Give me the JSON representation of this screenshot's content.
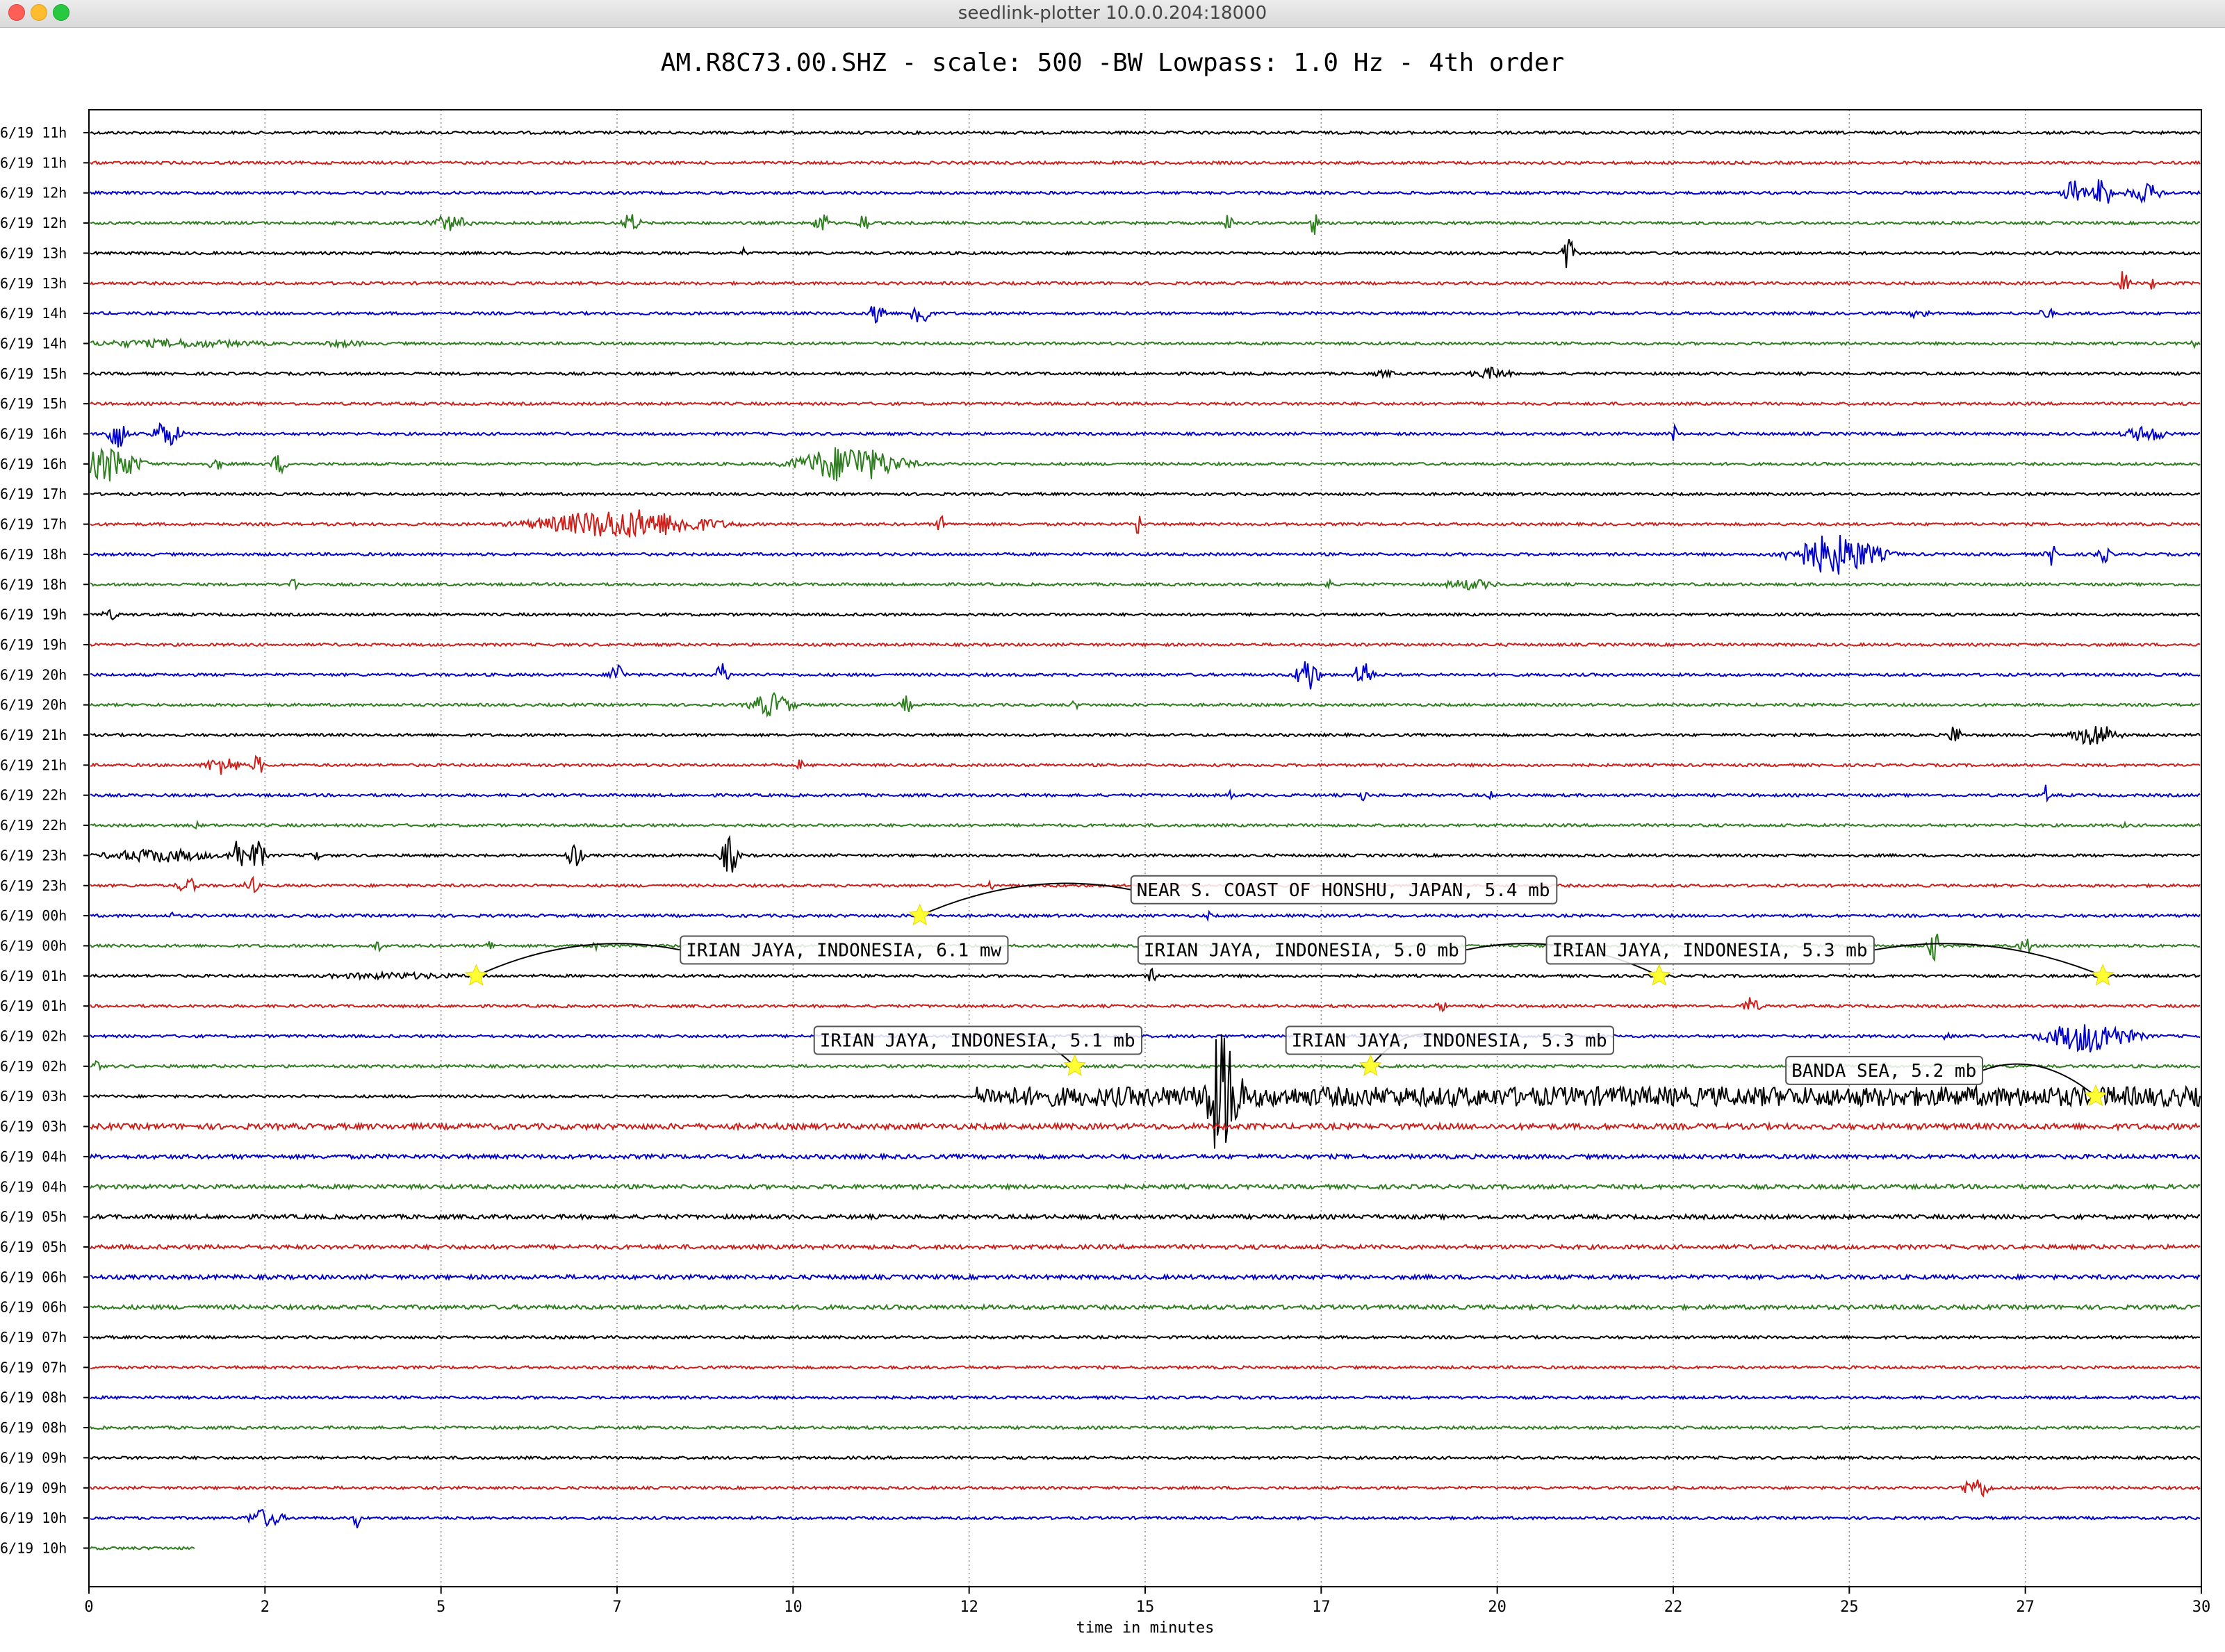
{
  "window": {
    "title": "seedlink-plotter 10.0.0.204:18000"
  },
  "chart_data": {
    "type": "line",
    "title": "AM.R8C73.00.SHZ - scale: 500 -BW Lowpass: 1.0 Hz - 4th order",
    "xlabel": "time in minutes",
    "ylabel": "",
    "xlim": [
      0,
      30
    ],
    "x_ticks": [
      "0",
      "2",
      "5",
      "7",
      "10",
      "12",
      "15",
      "17",
      "20",
      "22",
      "25",
      "27",
      "30"
    ],
    "grid": "vertical",
    "colors": [
      "#000000",
      "#cc1f1a",
      "#0000cc",
      "#2e7d1f"
    ],
    "traces": [
      {
        "label": "6/19 11h",
        "color": "#000000",
        "bursts": []
      },
      {
        "label": "6/19 11h",
        "color": "#cc1f1a",
        "bursts": []
      },
      {
        "label": "6/19 12h",
        "color": "#0000cc",
        "bursts": [
          [
            28.2,
            0.15,
            22
          ],
          [
            28.6,
            0.12,
            30
          ],
          [
            29.2,
            0.25,
            14
          ]
        ]
      },
      {
        "label": "6/19 12h",
        "color": "#2e7d1f",
        "bursts": [
          [
            5.1,
            0.3,
            12
          ],
          [
            7.7,
            0.12,
            16
          ],
          [
            10.4,
            0.1,
            18
          ],
          [
            11.0,
            0.08,
            16
          ],
          [
            16.2,
            0.06,
            18
          ],
          [
            17.4,
            0.06,
            18
          ]
        ]
      },
      {
        "label": "6/19 13h",
        "color": "#000000",
        "bursts": [
          [
            9.3,
            0.03,
            10
          ],
          [
            21.0,
            0.08,
            28
          ]
        ]
      },
      {
        "label": "6/19 13h",
        "color": "#cc1f1a",
        "bursts": [
          [
            28.9,
            0.08,
            20
          ],
          [
            29.3,
            0.04,
            10
          ]
        ]
      },
      {
        "label": "6/19 14h",
        "color": "#0000cc",
        "bursts": [
          [
            11.2,
            0.1,
            22
          ],
          [
            11.8,
            0.12,
            26
          ],
          [
            26.0,
            0.15,
            8
          ],
          [
            27.8,
            0.1,
            10
          ]
        ]
      },
      {
        "label": "6/19 14h",
        "color": "#2e7d1f",
        "bursts": [
          [
            1.2,
            1.5,
            6
          ],
          [
            3.6,
            0.4,
            5
          ],
          [
            29.9,
            0.04,
            10
          ]
        ]
      },
      {
        "label": "6/19 15h",
        "color": "#000000",
        "bursts": [
          [
            18.4,
            0.2,
            5
          ],
          [
            19.9,
            0.3,
            9
          ]
        ]
      },
      {
        "label": "6/19 15h",
        "color": "#cc1f1a",
        "bursts": []
      },
      {
        "label": "6/19 16h",
        "color": "#0000cc",
        "bursts": [
          [
            0.4,
            0.12,
            28
          ],
          [
            1.1,
            0.2,
            20
          ],
          [
            22.5,
            0.06,
            14
          ],
          [
            29.2,
            0.3,
            12
          ]
        ]
      },
      {
        "label": "6/19 16h",
        "color": "#2e7d1f",
        "bursts": [
          [
            0.3,
            0.4,
            26
          ],
          [
            1.8,
            0.1,
            10
          ],
          [
            2.7,
            0.1,
            16
          ],
          [
            10.8,
            0.7,
            28
          ]
        ]
      },
      {
        "label": "6/19 17h",
        "color": "#000000",
        "bursts": []
      },
      {
        "label": "6/19 17h",
        "color": "#cc1f1a",
        "bursts": [
          [
            7.6,
            1.2,
            22
          ],
          [
            12.1,
            0.06,
            14
          ],
          [
            14.9,
            0.04,
            20
          ]
        ]
      },
      {
        "label": "6/19 18h",
        "color": "#0000cc",
        "bursts": [
          [
            24.8,
            0.6,
            30
          ],
          [
            27.9,
            0.1,
            18
          ],
          [
            28.6,
            0.1,
            14
          ]
        ]
      },
      {
        "label": "6/19 18h",
        "color": "#2e7d1f",
        "bursts": [
          [
            2.9,
            0.06,
            12
          ],
          [
            17.6,
            0.04,
            10
          ],
          [
            19.6,
            0.4,
            8
          ]
        ]
      },
      {
        "label": "6/19 19h",
        "color": "#000000",
        "bursts": [
          [
            0.3,
            0.12,
            8
          ]
        ]
      },
      {
        "label": "6/19 19h",
        "color": "#cc1f1a",
        "bursts": []
      },
      {
        "label": "6/19 20h",
        "color": "#0000cc",
        "bursts": [
          [
            7.5,
            0.1,
            20
          ],
          [
            9.0,
            0.08,
            22
          ],
          [
            17.3,
            0.15,
            28
          ],
          [
            18.1,
            0.12,
            24
          ]
        ]
      },
      {
        "label": "6/19 20h",
        "color": "#2e7d1f",
        "bursts": [
          [
            9.7,
            0.3,
            18
          ],
          [
            11.6,
            0.08,
            14
          ],
          [
            14.0,
            0.05,
            8
          ]
        ]
      },
      {
        "label": "6/19 21h",
        "color": "#000000",
        "bursts": [
          [
            26.5,
            0.08,
            18
          ],
          [
            28.5,
            0.3,
            18
          ]
        ]
      },
      {
        "label": "6/19 21h",
        "color": "#cc1f1a",
        "bursts": [
          [
            1.9,
            0.25,
            14
          ],
          [
            2.4,
            0.08,
            16
          ],
          [
            10.1,
            0.04,
            10
          ]
        ]
      },
      {
        "label": "6/19 22h",
        "color": "#0000cc",
        "bursts": [
          [
            16.2,
            0.03,
            16
          ],
          [
            18.1,
            0.06,
            10
          ],
          [
            19.9,
            0.06,
            6
          ],
          [
            27.8,
            0.04,
            16
          ]
        ]
      },
      {
        "label": "6/19 22h",
        "color": "#2e7d1f",
        "bursts": [
          [
            1.5,
            0.1,
            6
          ],
          [
            28.9,
            0.04,
            6
          ]
        ]
      },
      {
        "label": "6/19 23h",
        "color": "#000000",
        "bursts": [
          [
            1.0,
            0.8,
            10
          ],
          [
            2.1,
            0.1,
            30
          ],
          [
            2.4,
            0.1,
            26
          ],
          [
            3.2,
            0.06,
            20
          ],
          [
            6.9,
            0.1,
            22
          ],
          [
            9.1,
            0.12,
            28
          ]
        ]
      },
      {
        "label": "6/19 23h",
        "color": "#cc1f1a",
        "bursts": [
          [
            1.4,
            0.15,
            12
          ],
          [
            2.3,
            0.1,
            14
          ],
          [
            12.8,
            0.04,
            10
          ]
        ]
      },
      {
        "label": "6/19 00h",
        "color": "#0000cc",
        "bursts": [
          [
            1.2,
            0.06,
            6
          ],
          [
            15.9,
            0.06,
            6
          ]
        ]
      },
      {
        "label": "6/19 00h",
        "color": "#2e7d1f",
        "bursts": [
          [
            4.1,
            0.06,
            10
          ],
          [
            5.7,
            0.06,
            10
          ],
          [
            7.2,
            0.05,
            8
          ],
          [
            26.2,
            0.1,
            22
          ],
          [
            27.5,
            0.08,
            14
          ]
        ]
      },
      {
        "label": "6/19 01h",
        "color": "#000000",
        "bursts": [
          [
            4.3,
            1.2,
            5
          ],
          [
            15.1,
            0.08,
            10
          ]
        ]
      },
      {
        "label": "6/19 01h",
        "color": "#cc1f1a",
        "bursts": [
          [
            19.2,
            0.1,
            8
          ],
          [
            23.6,
            0.12,
            14
          ]
        ]
      },
      {
        "label": "6/19 02h",
        "color": "#0000cc",
        "bursts": [
          [
            28.4,
            0.6,
            24
          ],
          [
            26.4,
            0.06,
            10
          ]
        ]
      },
      {
        "label": "6/19 02h",
        "color": "#2e7d1f",
        "bursts": [
          [
            0.1,
            0.06,
            12
          ]
        ]
      },
      {
        "label": "6/19 03h",
        "color": "#000000",
        "bursts": [
          [
            16.1,
            0.25,
            95
          ]
        ],
        "noise_from": 12.6,
        "noise_amp": 14
      },
      {
        "label": "6/19 03h",
        "color": "#cc1f1a",
        "bursts": [],
        "noise_amp": 4
      },
      {
        "label": "6/19 04h",
        "color": "#0000cc",
        "bursts": [],
        "noise_amp": 3
      },
      {
        "label": "6/19 04h",
        "color": "#2e7d1f",
        "bursts": [],
        "noise_amp": 3
      },
      {
        "label": "6/19 05h",
        "color": "#000000",
        "bursts": [],
        "noise_amp": 3
      },
      {
        "label": "6/19 05h",
        "color": "#cc1f1a",
        "bursts": [],
        "noise_amp": 3
      },
      {
        "label": "6/19 06h",
        "color": "#0000cc",
        "bursts": [],
        "noise_amp": 3
      },
      {
        "label": "6/19 06h",
        "color": "#2e7d1f",
        "bursts": [],
        "noise_amp": 3
      },
      {
        "label": "6/19 07h",
        "color": "#000000",
        "bursts": []
      },
      {
        "label": "6/19 07h",
        "color": "#cc1f1a",
        "bursts": []
      },
      {
        "label": "6/19 08h",
        "color": "#0000cc",
        "bursts": []
      },
      {
        "label": "6/19 08h",
        "color": "#2e7d1f",
        "bursts": []
      },
      {
        "label": "6/19 09h",
        "color": "#000000",
        "bursts": []
      },
      {
        "label": "6/19 09h",
        "color": "#cc1f1a",
        "bursts": [
          [
            26.8,
            0.2,
            16
          ]
        ]
      },
      {
        "label": "6/19 10h",
        "color": "#0000cc",
        "bursts": [
          [
            2.5,
            0.25,
            14
          ],
          [
            3.8,
            0.04,
            20
          ]
        ]
      },
      {
        "label": "6/19 10h",
        "color": "#2e7d1f",
        "bursts": [],
        "end": 1.5
      }
    ],
    "events": [
      {
        "label": "NEAR S. COAST OF HONSHU, JAPAN, 5.4 mb",
        "trace": 26,
        "x": 11.8,
        "label_trace": 25.5,
        "label_x": 14.8
      },
      {
        "label": "IRIAN JAYA, INDONESIA, 6.1 mw",
        "trace": 28,
        "x": 5.5,
        "label_trace": 27.5,
        "label_x": 8.4
      },
      {
        "label": "IRIAN JAYA, INDONESIA, 5.0 mb",
        "trace": 28,
        "x": 22.3,
        "label_trace": 27.5,
        "label_x": 14.9
      },
      {
        "label": "IRIAN JAYA, INDONESIA, 5.3 mb",
        "trace": 28,
        "x": 28.6,
        "label_trace": 27.5,
        "label_x": 20.7
      },
      {
        "label": "IRIAN JAYA, INDONESIA, 5.1 mb",
        "trace": 31,
        "x": 14.0,
        "label_trace": 30.5,
        "label_x": 10.3
      },
      {
        "label": "IRIAN JAYA, INDONESIA, 5.3 mb",
        "trace": 31,
        "x": 18.2,
        "label_trace": 30.5,
        "label_x": 17.0
      },
      {
        "label": "BANDA SEA, 5.2 mb",
        "trace": 32,
        "x": 28.5,
        "label_trace": 31.5,
        "label_x": 24.1
      }
    ]
  }
}
